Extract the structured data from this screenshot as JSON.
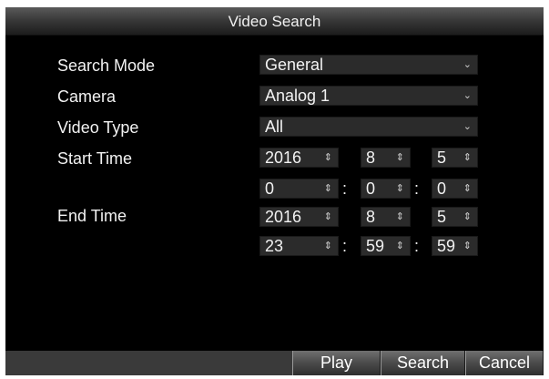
{
  "dialog": {
    "title": "Video Search"
  },
  "form": {
    "search_mode": {
      "label": "Search Mode",
      "value": "General"
    },
    "camera": {
      "label": "Camera",
      "value": "Analog 1"
    },
    "video_type": {
      "label": "Video Type",
      "value": "All"
    },
    "start_time": {
      "label": "Start Time",
      "year": "2016",
      "month": "8",
      "day": "5",
      "hour": "0",
      "minute": "0",
      "second": "0"
    },
    "end_time": {
      "label": "End Time",
      "year": "2016",
      "month": "8",
      "day": "5",
      "hour": "23",
      "minute": "59",
      "second": "59"
    },
    "time_separator": ":",
    "dropdown_glyph": "⌄",
    "spinner_glyph": "⇕"
  },
  "buttons": {
    "play": "Play",
    "search": "Search",
    "cancel": "Cancel"
  },
  "icons": {
    "dropdown": "chevron-down-icon",
    "spinner": "spinner-icon"
  },
  "colors": {
    "background": "#000000",
    "field": "#2b2b2b",
    "footer": "#3a3a3a",
    "text": "#f2f2f2"
  }
}
